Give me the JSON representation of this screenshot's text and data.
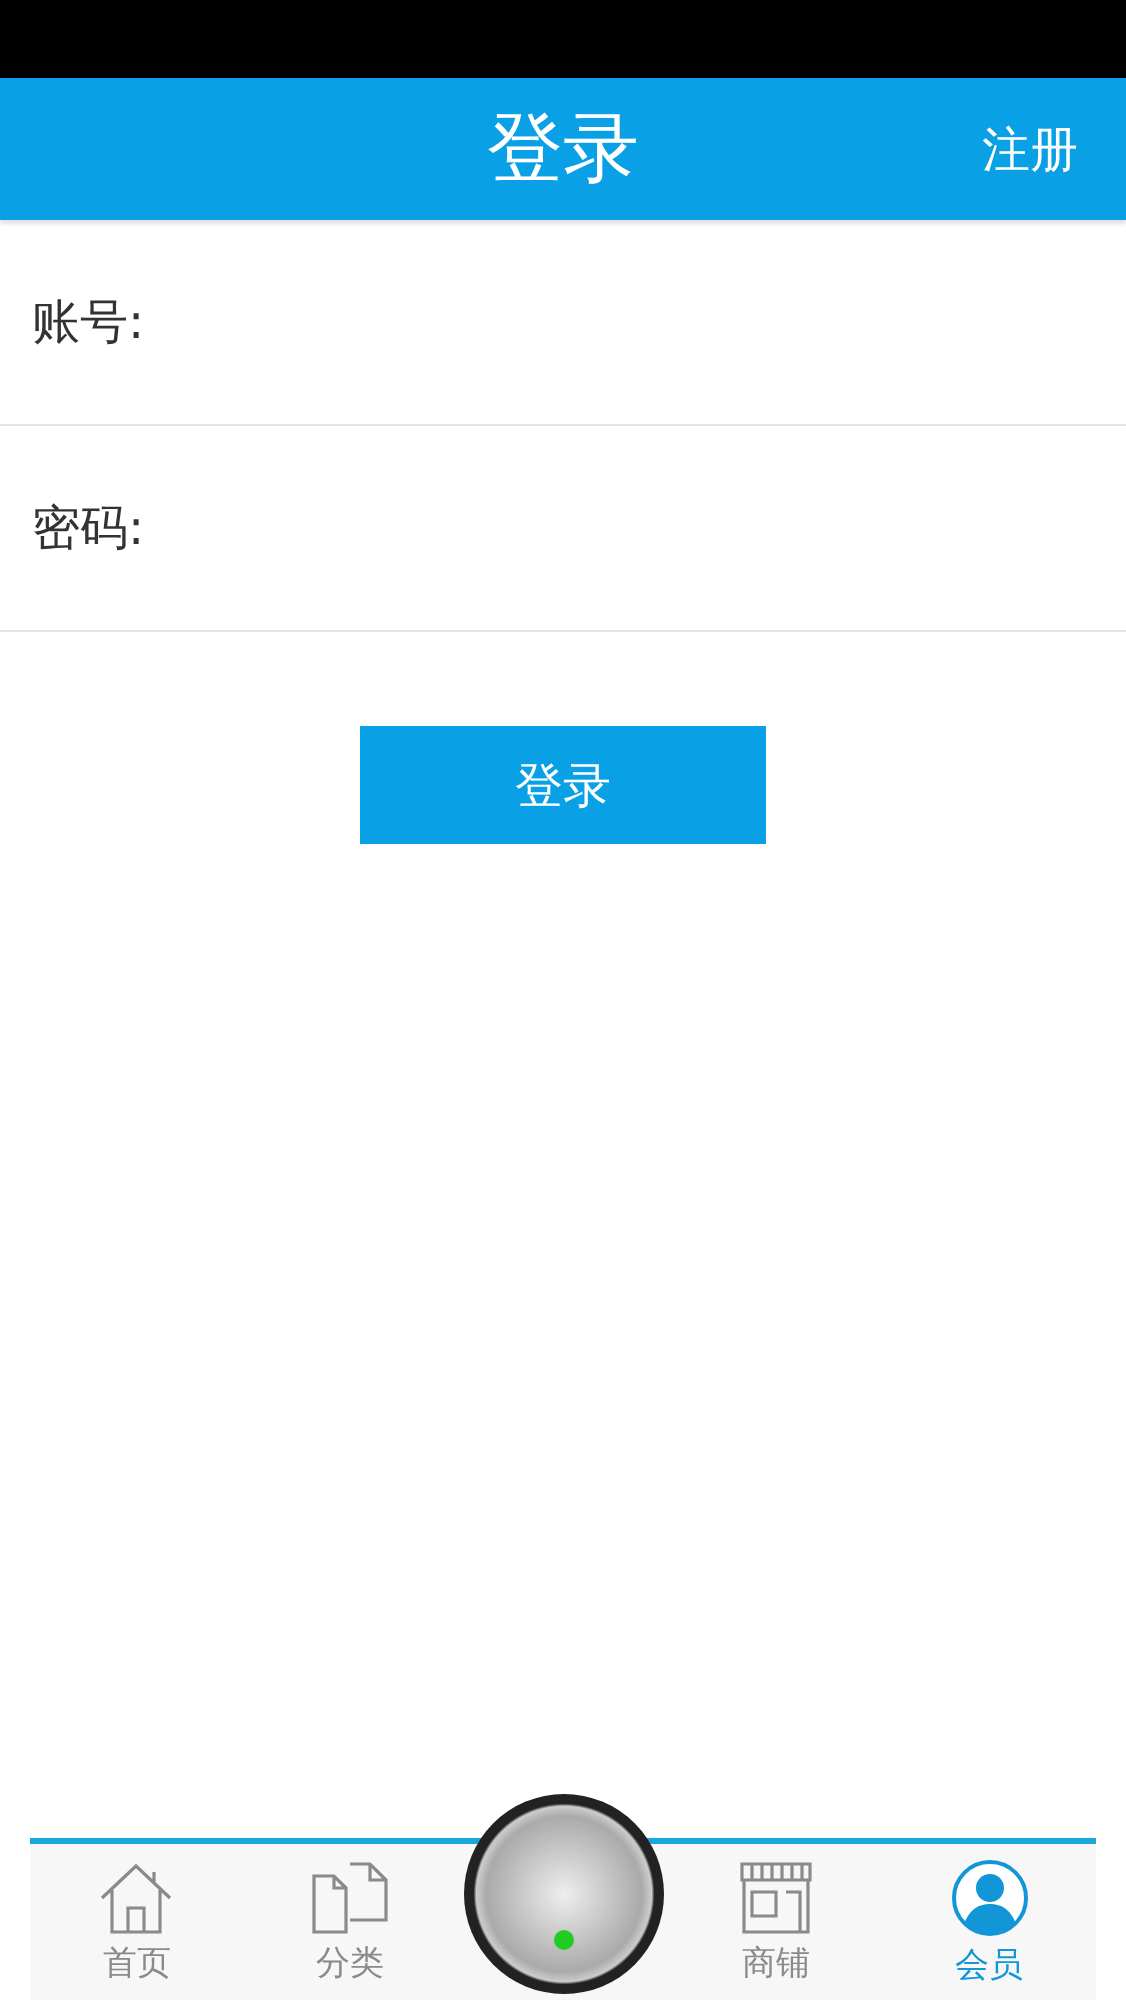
{
  "header": {
    "title": "登录",
    "action": "注册"
  },
  "fields": [
    {
      "label": "账号:"
    },
    {
      "label": "密码:"
    }
  ],
  "login_button": "登录",
  "nav": [
    {
      "label": "首页",
      "kind": "home",
      "selected": false
    },
    {
      "label": "分类",
      "kind": "docs",
      "selected": false
    },
    {
      "label": "商铺",
      "kind": "shop",
      "selected": false
    },
    {
      "label": "会员",
      "kind": "member",
      "selected": true
    }
  ]
}
